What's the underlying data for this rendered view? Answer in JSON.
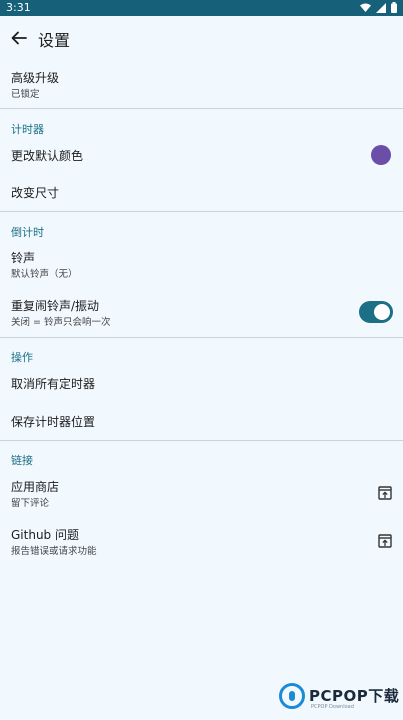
{
  "status_bar": {
    "time": "3:31",
    "icons": [
      "wifi-icon",
      "signal-icon",
      "battery-icon"
    ]
  },
  "app_bar": {
    "title": "设置",
    "back_icon": "arrow-left-icon"
  },
  "items": {
    "upgrade": {
      "title": "高级升级",
      "subtitle": "已锁定"
    },
    "change_color": {
      "title": "更改默认颜色"
    },
    "change_size": {
      "title": "改变尺寸"
    },
    "ringtone": {
      "title": "铃声",
      "subtitle": "默认铃声（无）"
    },
    "repeat_alarm": {
      "title": "重复闹铃声/振动",
      "subtitle": "关闭 = 铃声只会响一次",
      "enabled": true
    },
    "cancel_timers": {
      "title": "取消所有定时器"
    },
    "save_position": {
      "title": "保存计时器位置"
    },
    "app_store": {
      "title": "应用商店",
      "subtitle": "留下评论"
    },
    "github": {
      "title": "Github 问题",
      "subtitle": "报告错误或请求功能"
    }
  },
  "sections": {
    "timer": "计时器",
    "countdown": "倒计时",
    "actions": "操作",
    "links": "链接"
  },
  "colors": {
    "accent": "#1b6f86",
    "status_bar": "#16607a",
    "swatch": "#6a4ea8",
    "background": "#f1f8fe"
  },
  "watermark": {
    "brand": "PCPOP下载",
    "tagline": "PCPOP Download"
  }
}
